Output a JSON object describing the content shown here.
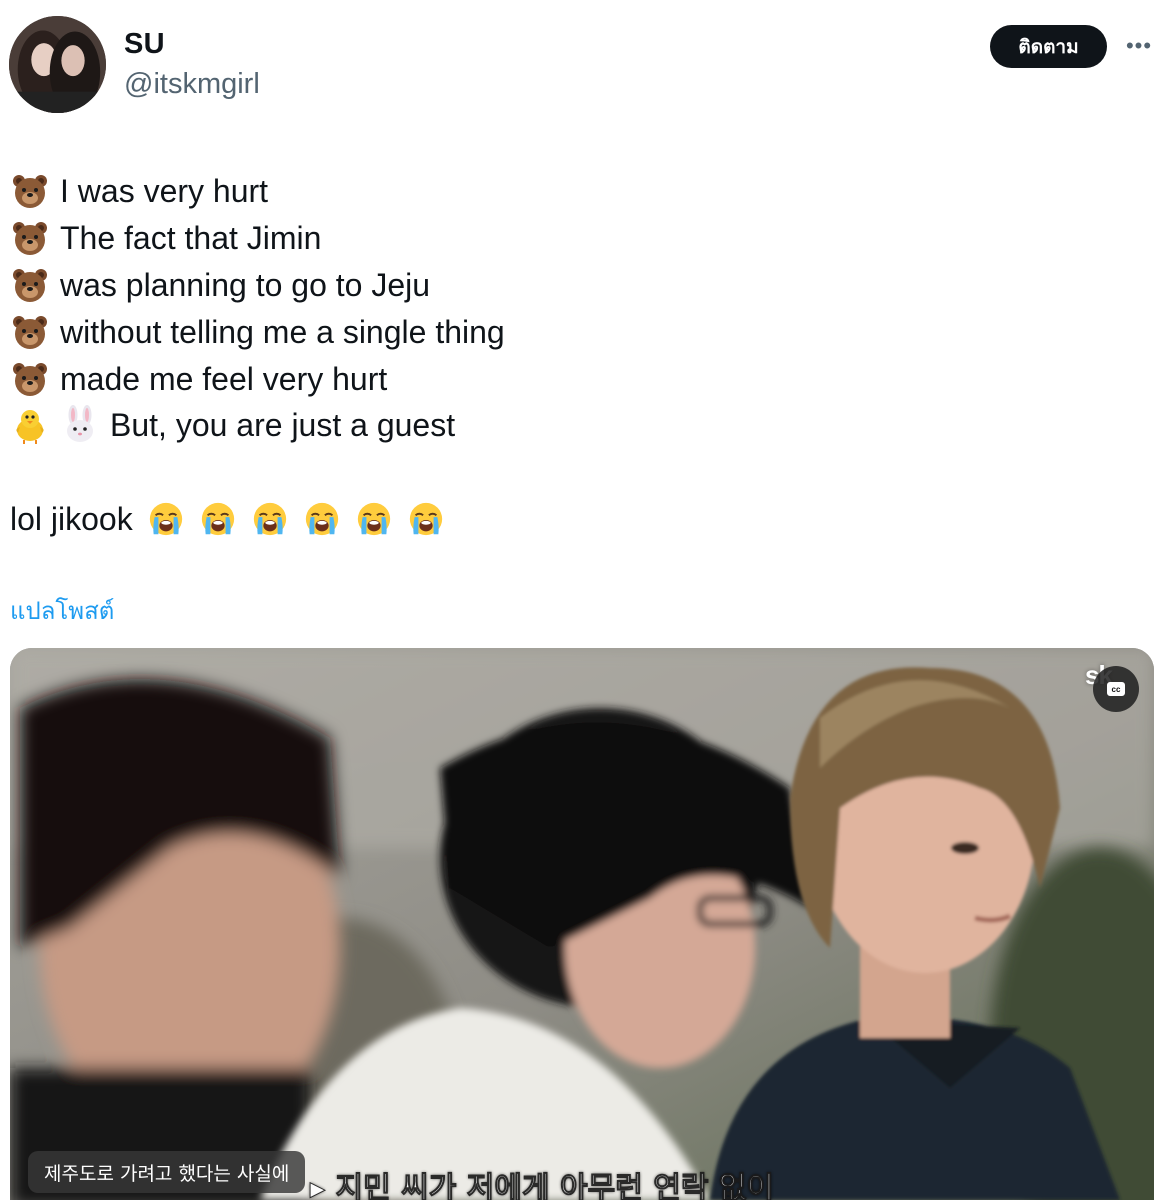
{
  "author": {
    "display_name": "SU",
    "handle": "@itskmgirl"
  },
  "actions": {
    "follow_label": "ติดตาม",
    "more_label": "•••"
  },
  "tweet": {
    "lines": [
      {
        "emojis": [
          "bear-face"
        ],
        "text": "I was very hurt"
      },
      {
        "emojis": [
          "bear-face"
        ],
        "text": "The fact that Jimin"
      },
      {
        "emojis": [
          "bear-face"
        ],
        "text": "was planning to go to Jeju"
      },
      {
        "emojis": [
          "bear-face"
        ],
        "text": "without telling me a single thing"
      },
      {
        "emojis": [
          "bear-face"
        ],
        "text": "made me feel very hurt"
      },
      {
        "emojis": [
          "chick",
          "rabbit-face"
        ],
        "text": "But, you are just a guest"
      }
    ],
    "footer_text": "lol jikook",
    "footer_emojis": [
      "loudly-crying-face",
      "loudly-crying-face",
      "loudly-crying-face",
      "loudly-crying-face",
      "loudly-crying-face",
      "loudly-crying-face"
    ]
  },
  "translate_label": "แปลโพสต์",
  "media": {
    "watermark": "sk",
    "cc_icon": "closed-captions-icon",
    "cc_label": "cc",
    "caption_pill": "제주도로 가려고 했다는 사실에",
    "caption_burned": "▸ 지민 씨가 저에게 아무런 연락 없이"
  },
  "colors": {
    "text": "#0f1419",
    "secondary": "#536471",
    "link": "#1d9bf0",
    "follow_bg": "#0f1419",
    "follow_text": "#ffffff"
  }
}
